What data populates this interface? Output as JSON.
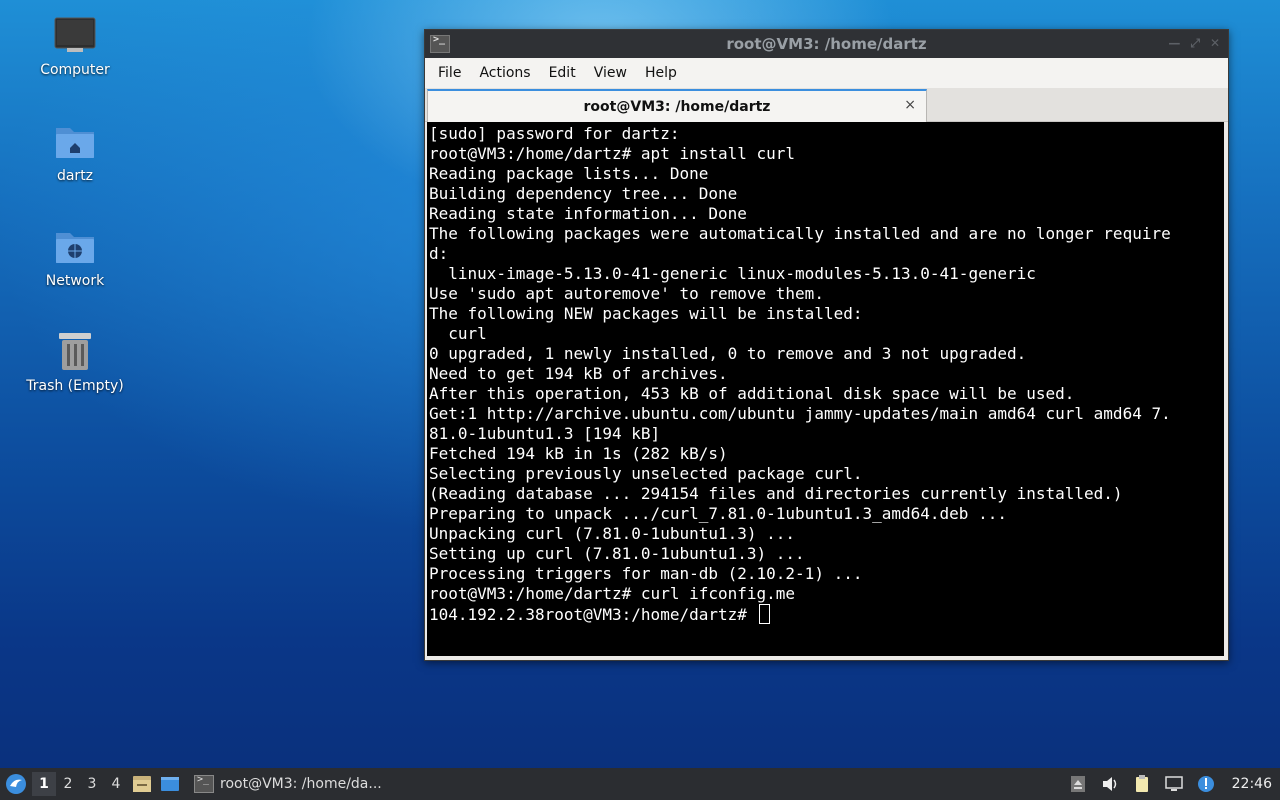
{
  "desktop": {
    "icons": [
      {
        "label": "Computer",
        "icon": "computer-icon"
      },
      {
        "label": "dartz",
        "icon": "home-folder-icon"
      },
      {
        "label": "Network",
        "icon": "network-folder-icon"
      },
      {
        "label": "Trash (Empty)",
        "icon": "trash-icon"
      }
    ]
  },
  "window": {
    "title": "root@VM3: /home/dartz",
    "menu": [
      "File",
      "Actions",
      "Edit",
      "View",
      "Help"
    ],
    "tab_label": "root@VM3: /home/dartz",
    "tab_close": "×"
  },
  "terminal": {
    "lines": [
      "[sudo] password for dartz:",
      "root@VM3:/home/dartz# apt install curl",
      "Reading package lists... Done",
      "Building dependency tree... Done",
      "Reading state information... Done",
      "The following packages were automatically installed and are no longer require",
      "d:",
      "  linux-image-5.13.0-41-generic linux-modules-5.13.0-41-generic",
      "Use 'sudo apt autoremove' to remove them.",
      "The following NEW packages will be installed:",
      "  curl",
      "0 upgraded, 1 newly installed, 0 to remove and 3 not upgraded.",
      "Need to get 194 kB of archives.",
      "After this operation, 453 kB of additional disk space will be used.",
      "Get:1 http://archive.ubuntu.com/ubuntu jammy-updates/main amd64 curl amd64 7.",
      "81.0-1ubuntu1.3 [194 kB]",
      "Fetched 194 kB in 1s (282 kB/s)",
      "Selecting previously unselected package curl.",
      "(Reading database ... 294154 files and directories currently installed.)",
      "Preparing to unpack .../curl_7.81.0-1ubuntu1.3_amd64.deb ...",
      "Unpacking curl (7.81.0-1ubuntu1.3) ...",
      "Setting up curl (7.81.0-1ubuntu1.3) ...",
      "Processing triggers for man-db (2.10.2-1) ...",
      "root@VM3:/home/dartz# curl ifconfig.me",
      "104.192.2.38root@VM3:/home/dartz# "
    ]
  },
  "taskbar": {
    "workspaces": [
      "1",
      "2",
      "3",
      "4"
    ],
    "active_workspace": "1",
    "task_label": "root@VM3: /home/da...",
    "clock": "22:46"
  }
}
